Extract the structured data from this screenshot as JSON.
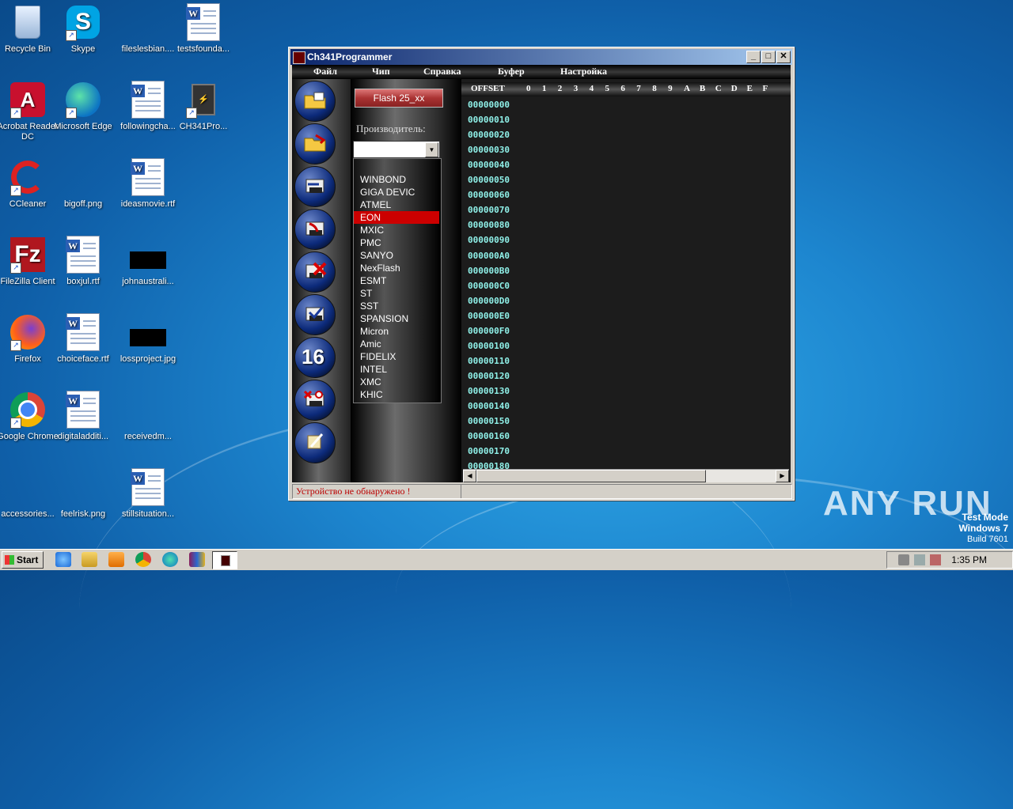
{
  "desktop": {
    "icons": [
      {
        "label": "Recycle Bin",
        "icon": "recycle-bin-icon"
      },
      {
        "label": "Skype",
        "icon": "skype-icon"
      },
      {
        "label": "fileslesbian....",
        "icon": "blank-file-icon"
      },
      {
        "label": "testsfounda...",
        "icon": "word-doc-icon"
      },
      {
        "label": "Acrobat Reader DC",
        "icon": "acrobat-icon"
      },
      {
        "label": "Microsoft Edge",
        "icon": "edge-icon"
      },
      {
        "label": "followingcha...",
        "icon": "word-doc-icon"
      },
      {
        "label": "CH341Pro...",
        "icon": "ch341-icon"
      },
      {
        "label": "CCleaner",
        "icon": "ccleaner-icon"
      },
      {
        "label": "bigoff.png",
        "icon": "blank-file-icon"
      },
      {
        "label": "ideasmovie.rtf",
        "icon": "word-doc-icon"
      },
      {
        "label": "FileZilla Client",
        "icon": "filezilla-icon"
      },
      {
        "label": "boxjul.rtf",
        "icon": "word-doc-icon"
      },
      {
        "label": "johnaustrali...",
        "icon": "image-thumb-icon"
      },
      {
        "label": "Firefox",
        "icon": "firefox-icon"
      },
      {
        "label": "choiceface.rtf",
        "icon": "word-doc-icon"
      },
      {
        "label": "lossproject.jpg",
        "icon": "image-thumb-icon"
      },
      {
        "label": "Google Chrome",
        "icon": "chrome-icon"
      },
      {
        "label": "digitaladditi...",
        "icon": "word-doc-icon"
      },
      {
        "label": "receivedm...",
        "icon": "blank-file-icon"
      },
      {
        "label": "accessories...",
        "icon": "blank-file-icon"
      },
      {
        "label": "feelrisk.png",
        "icon": "blank-file-icon"
      },
      {
        "label": "stillsituation...",
        "icon": "word-doc-icon"
      }
    ]
  },
  "window": {
    "title": "Ch341Programmer",
    "controls": {
      "minimize": "_",
      "maximize": "□",
      "close": "✕"
    },
    "menu": [
      "Файл",
      "Чип",
      "Справка",
      "Буфер",
      "Настройка"
    ],
    "toolbar_buttons": [
      "open-file-icon",
      "save-file-icon",
      "read-chip-icon",
      "write-chip-icon",
      "erase-chip-icon",
      "verify-chip-icon",
      "hex-16-icon",
      "auto-program-icon",
      "about-icon"
    ],
    "toolbar_16_label": "16",
    "chip_button": "Flash 25_xx",
    "manufacturer_label": "Производитель:",
    "manufacturer_value": "",
    "manufacturers": [
      "WINBOND",
      "GIGA DEVIC",
      "ATMEL",
      "EON",
      "MXIC",
      "PMC",
      "SANYO",
      "NexFlash",
      "ESMT",
      "ST",
      "SST",
      "SPANSION",
      "Micron",
      "Amic",
      "FIDELIX",
      "INTEL",
      "XMC",
      "KHIC"
    ],
    "selected_manufacturer": "EON",
    "hex_header": {
      "offset": "OFFSET",
      "columns": [
        "0",
        "1",
        "2",
        "3",
        "4",
        "5",
        "6",
        "7",
        "8",
        "9",
        "A",
        "B",
        "C",
        "D",
        "E",
        "F"
      ]
    },
    "offsets": [
      "00000000",
      "00000010",
      "00000020",
      "00000030",
      "00000040",
      "00000050",
      "00000060",
      "00000070",
      "00000080",
      "00000090",
      "000000A0",
      "000000B0",
      "000000C0",
      "000000D0",
      "000000E0",
      "000000F0",
      "00000100",
      "00000110",
      "00000120",
      "00000130",
      "00000140",
      "00000150",
      "00000160",
      "00000170",
      "00000180"
    ],
    "status": "Устройство не обнаружено !"
  },
  "watermark": {
    "brand": "ANY RUN",
    "test_mode": "Test Mode",
    "os": "Windows 7",
    "build": "Build 7601"
  },
  "taskbar": {
    "start_label": "Start",
    "pinned": [
      "ie-icon",
      "explorer-icon",
      "media-player-icon",
      "chrome-icon",
      "edge-icon",
      "winrar-icon",
      "ch341-task-icon"
    ],
    "clock": "1:35 PM"
  }
}
